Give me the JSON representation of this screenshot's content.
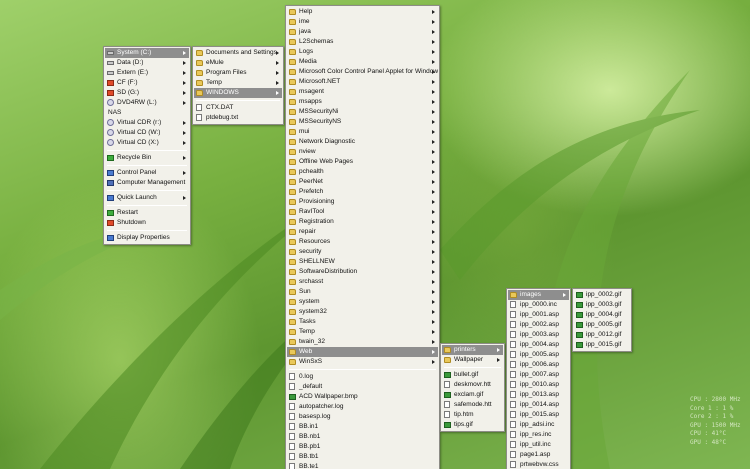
{
  "desktop_menu": [
    {
      "label": "System (C:)",
      "icon": "drive-icon",
      "arrow": true,
      "selected": true
    },
    {
      "label": "Data (D:)",
      "icon": "drive-icon",
      "arrow": true
    },
    {
      "label": "Extern (E:)",
      "icon": "drive-icon",
      "arrow": true
    },
    {
      "label": "CF (F:)",
      "icon": "flash-card-icon",
      "arrow": true
    },
    {
      "label": "SD (G:)",
      "icon": "sd-card-icon",
      "arrow": true
    },
    {
      "label": "DVD4RW (L:)",
      "icon": "dvd-drive-icon",
      "arrow": true
    },
    {
      "label": "NAS",
      "icon": "",
      "arrow": false
    },
    {
      "label": "Virtual CDR (r:)",
      "icon": "virtual-cd-icon",
      "arrow": true
    },
    {
      "label": "Virtual CD (W:)",
      "icon": "virtual-cd-icon",
      "arrow": true
    },
    {
      "label": "Virtual CD (X:)",
      "icon": "virtual-cd-icon",
      "arrow": true
    },
    {
      "sep": true
    },
    {
      "label": "Recycle Bin",
      "icon": "recycle-bin-icon",
      "arrow": true
    },
    {
      "sep": true
    },
    {
      "label": "Control Panel",
      "icon": "control-panel-icon",
      "arrow": true
    },
    {
      "label": "Computer Management",
      "icon": "computer-management-icon",
      "arrow": false
    },
    {
      "sep": true
    },
    {
      "label": "Quick Launch",
      "icon": "quick-launch-icon",
      "arrow": true
    },
    {
      "sep": true
    },
    {
      "label": "Restart",
      "icon": "restart-icon",
      "arrow": false
    },
    {
      "label": "Shutdown",
      "icon": "shutdown-icon",
      "arrow": false
    },
    {
      "sep": true
    },
    {
      "label": "Display Properties",
      "icon": "display-properties-icon",
      "arrow": false
    }
  ],
  "system_c_menu": [
    {
      "label": "Documents and Settings",
      "icon": "folder-icon",
      "arrow": true
    },
    {
      "label": "eMule",
      "icon": "folder-icon",
      "arrow": true
    },
    {
      "label": "Program Files",
      "icon": "folder-icon",
      "arrow": true
    },
    {
      "label": "Temp",
      "icon": "folder-icon",
      "arrow": true
    },
    {
      "label": "WINDOWS",
      "icon": "folder-icon",
      "arrow": true,
      "selected": true
    },
    {
      "sep": true
    },
    {
      "label": "CTX.DAT",
      "icon": "file-icon",
      "arrow": false
    },
    {
      "label": "ptdebug.txt",
      "icon": "text-file-icon",
      "arrow": false
    }
  ],
  "windows_menu": [
    {
      "label": "Help",
      "icon": "folder-icon",
      "arrow": true
    },
    {
      "label": "ime",
      "icon": "folder-icon",
      "arrow": true
    },
    {
      "label": "java",
      "icon": "folder-icon",
      "arrow": true
    },
    {
      "label": "L2Schemas",
      "icon": "folder-icon",
      "arrow": true
    },
    {
      "label": "Logs",
      "icon": "folder-icon",
      "arrow": true
    },
    {
      "label": "Media",
      "icon": "folder-icon",
      "arrow": true
    },
    {
      "label": "Microsoft Color Control Panel Applet for Windows XP",
      "icon": "folder-icon",
      "arrow": true
    },
    {
      "label": "Microsoft.NET",
      "icon": "folder-icon",
      "arrow": true
    },
    {
      "label": "msagent",
      "icon": "folder-icon",
      "arrow": true
    },
    {
      "label": "msapps",
      "icon": "folder-icon",
      "arrow": true
    },
    {
      "label": "MSSecurityNi",
      "icon": "folder-icon",
      "arrow": true
    },
    {
      "label": "MSSecurityNS",
      "icon": "folder-icon",
      "arrow": true
    },
    {
      "label": "mui",
      "icon": "folder-icon",
      "arrow": true
    },
    {
      "label": "Network Diagnostic",
      "icon": "folder-icon",
      "arrow": true
    },
    {
      "label": "nview",
      "icon": "folder-icon",
      "arrow": true
    },
    {
      "label": "Offline Web Pages",
      "icon": "folder-icon",
      "arrow": true
    },
    {
      "label": "pchealth",
      "icon": "folder-icon",
      "arrow": true
    },
    {
      "label": "PeerNet",
      "icon": "folder-icon",
      "arrow": true
    },
    {
      "label": "Prefetch",
      "icon": "folder-icon",
      "arrow": true
    },
    {
      "label": "Provisioning",
      "icon": "folder-icon",
      "arrow": true
    },
    {
      "label": "RavITool",
      "icon": "folder-icon",
      "arrow": true
    },
    {
      "label": "Registration",
      "icon": "folder-icon",
      "arrow": true
    },
    {
      "label": "repair",
      "icon": "folder-icon",
      "arrow": true
    },
    {
      "label": "Resources",
      "icon": "folder-icon",
      "arrow": true
    },
    {
      "label": "security",
      "icon": "folder-icon",
      "arrow": true
    },
    {
      "label": "SHELLNEW",
      "icon": "folder-icon",
      "arrow": true
    },
    {
      "label": "SoftwareDistribution",
      "icon": "folder-icon",
      "arrow": true
    },
    {
      "label": "srchasst",
      "icon": "folder-icon",
      "arrow": true
    },
    {
      "label": "Sun",
      "icon": "folder-icon",
      "arrow": true
    },
    {
      "label": "system",
      "icon": "folder-icon",
      "arrow": true
    },
    {
      "label": "system32",
      "icon": "folder-icon",
      "arrow": true
    },
    {
      "label": "Tasks",
      "icon": "folder-icon",
      "arrow": true
    },
    {
      "label": "Temp",
      "icon": "folder-icon",
      "arrow": true
    },
    {
      "label": "twain_32",
      "icon": "folder-icon",
      "arrow": true
    },
    {
      "label": "Web",
      "icon": "folder-icon",
      "arrow": true,
      "selected": true
    },
    {
      "label": "WinSxS",
      "icon": "folder-icon",
      "arrow": true
    },
    {
      "sep": true
    },
    {
      "label": "0.log",
      "icon": "text-file-icon",
      "arrow": false
    },
    {
      "label": "_default",
      "icon": "file-icon",
      "arrow": false
    },
    {
      "label": "ACD Wallpaper.bmp",
      "icon": "image-file-icon",
      "arrow": false
    },
    {
      "label": "autopatcher.log",
      "icon": "text-file-icon",
      "arrow": false
    },
    {
      "label": "basesp.log",
      "icon": "text-file-icon",
      "arrow": false
    },
    {
      "label": "BB.in1",
      "icon": "file-icon",
      "arrow": false
    },
    {
      "label": "BB.nb1",
      "icon": "file-icon",
      "arrow": false
    },
    {
      "label": "BB.pb1",
      "icon": "file-icon",
      "arrow": false
    },
    {
      "label": "BB.tb1",
      "icon": "file-icon",
      "arrow": false
    },
    {
      "label": "BB.te1",
      "icon": "file-icon",
      "arrow": false
    }
  ],
  "web_menu": [
    {
      "label": "printers",
      "icon": "folder-icon",
      "arrow": true,
      "selected": true
    },
    {
      "label": "Wallpaper",
      "icon": "folder-icon",
      "arrow": true
    },
    {
      "sep": true
    },
    {
      "label": "bullet.gif",
      "icon": "gif-file-icon",
      "arrow": false
    },
    {
      "label": "deskmovr.htt",
      "icon": "htt-file-icon",
      "arrow": false
    },
    {
      "label": "exclam.gif",
      "icon": "gif-file-icon",
      "arrow": false
    },
    {
      "label": "safemode.htt",
      "icon": "htt-file-icon",
      "arrow": false
    },
    {
      "label": "tip.htm",
      "icon": "htm-file-icon",
      "arrow": false
    },
    {
      "label": "tips.gif",
      "icon": "gif-file-icon",
      "arrow": false
    }
  ],
  "printers_menu": [
    {
      "label": "images",
      "icon": "folder-icon",
      "arrow": true,
      "selected": true
    },
    {
      "label": "ipp_0000.inc",
      "icon": "file-icon",
      "arrow": false
    },
    {
      "label": "ipp_0001.asp",
      "icon": "file-icon",
      "arrow": false
    },
    {
      "label": "ipp_0002.asp",
      "icon": "file-icon",
      "arrow": false
    },
    {
      "label": "ipp_0003.asp",
      "icon": "file-icon",
      "arrow": false
    },
    {
      "label": "ipp_0004.asp",
      "icon": "file-icon",
      "arrow": false
    },
    {
      "label": "ipp_0005.asp",
      "icon": "file-icon",
      "arrow": false
    },
    {
      "label": "ipp_0006.asp",
      "icon": "file-icon",
      "arrow": false
    },
    {
      "label": "ipp_0007.asp",
      "icon": "file-icon",
      "arrow": false
    },
    {
      "label": "ipp_0010.asp",
      "icon": "file-icon",
      "arrow": false
    },
    {
      "label": "ipp_0013.asp",
      "icon": "file-icon",
      "arrow": false
    },
    {
      "label": "ipp_0014.asp",
      "icon": "file-icon",
      "arrow": false
    },
    {
      "label": "ipp_0015.asp",
      "icon": "file-icon",
      "arrow": false
    },
    {
      "label": "ipp_adsi.inc",
      "icon": "file-icon",
      "arrow": false
    },
    {
      "label": "ipp_res.inc",
      "icon": "file-icon",
      "arrow": false
    },
    {
      "label": "ipp_util.inc",
      "icon": "file-icon",
      "arrow": false
    },
    {
      "label": "page1.asp",
      "icon": "file-icon",
      "arrow": false
    },
    {
      "label": "prtwebvw.css",
      "icon": "file-icon",
      "arrow": false
    }
  ],
  "images_menu": [
    {
      "label": "ipp_0002.gif",
      "icon": "gif-file-icon",
      "arrow": false
    },
    {
      "label": "ipp_0003.gif",
      "icon": "gif-file-icon",
      "arrow": false
    },
    {
      "label": "ipp_0004.gif",
      "icon": "gif-file-icon",
      "arrow": false
    },
    {
      "label": "ipp_0005.gif",
      "icon": "gif-file-icon",
      "arrow": false
    },
    {
      "label": "ipp_0012.gif",
      "icon": "gif-file-icon",
      "arrow": false
    },
    {
      "label": "ipp_0015.gif",
      "icon": "gif-file-icon",
      "arrow": false
    }
  ],
  "stats_overlay": [
    "CPU : 2800 MHz",
    "Core 1 : 1 %",
    "Core 2 : 1 %",
    "GPU : 1500 MHz",
    "CPU : 41°C",
    "GPU : 48°C"
  ]
}
